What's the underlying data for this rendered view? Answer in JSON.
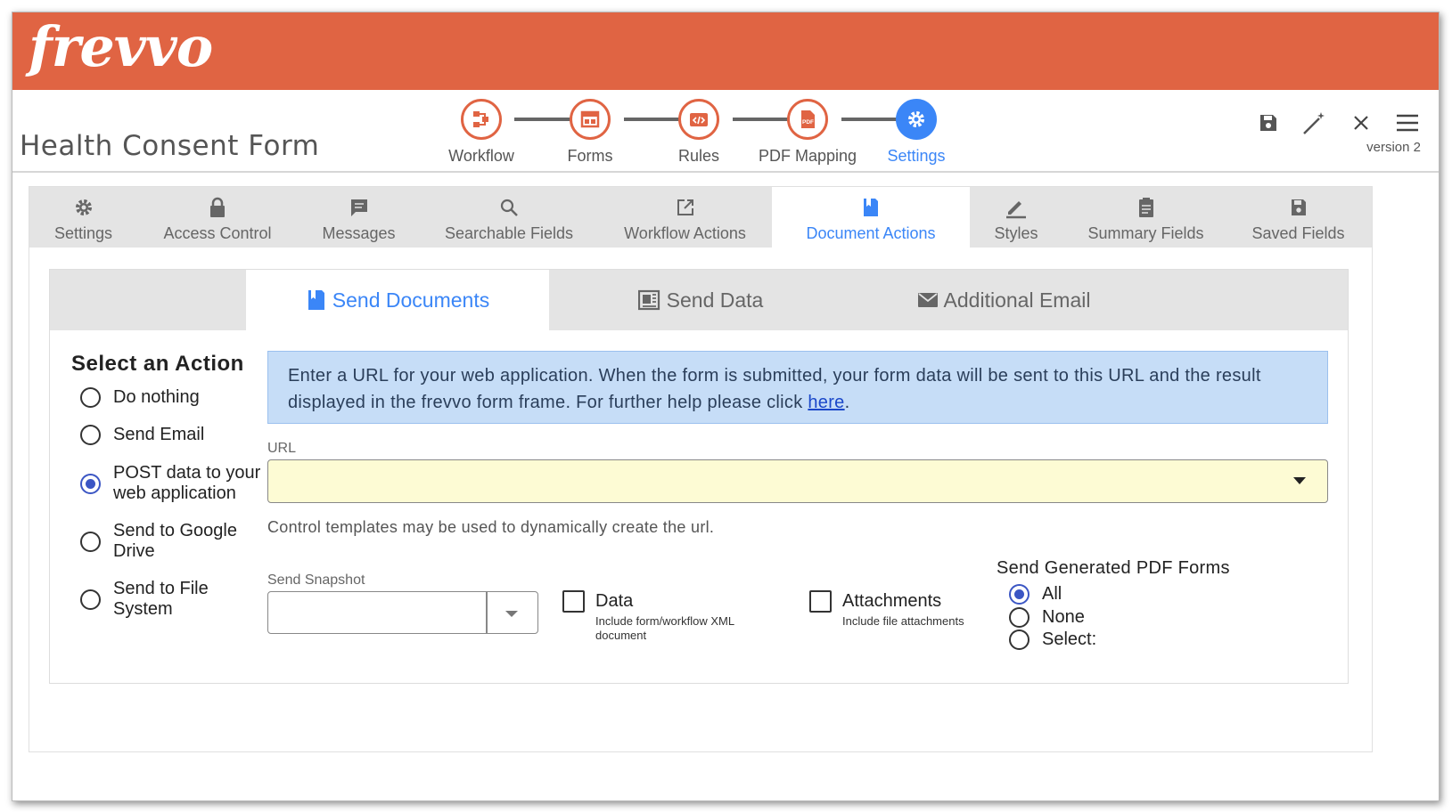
{
  "app": {
    "logo_text": "frevvo",
    "form_title": "Health Consent Form",
    "version": "version 2",
    "colors": {
      "brand": "#e06443",
      "accent": "#3b86f7",
      "info_bg": "#c6ddf7",
      "url_bg": "#fdfbd4"
    }
  },
  "steps": [
    {
      "label": "Workflow",
      "icon": "workflow-icon"
    },
    {
      "label": "Forms",
      "icon": "forms-icon"
    },
    {
      "label": "Rules",
      "icon": "rules-code-icon"
    },
    {
      "label": "PDF Mapping",
      "icon": "pdf-icon"
    },
    {
      "label": "Settings",
      "icon": "gear-icon",
      "active": true
    }
  ],
  "toolbar": {
    "icons": [
      "save-icon",
      "magic-wand-icon",
      "close-icon",
      "hamburger-menu-icon"
    ]
  },
  "settings_tabs": [
    {
      "label": "Settings",
      "icon": "gear-icon"
    },
    {
      "label": "Access Control",
      "icon": "lock-icon"
    },
    {
      "label": "Messages",
      "icon": "message-icon"
    },
    {
      "label": "Searchable Fields",
      "icon": "search-icon"
    },
    {
      "label": "Workflow Actions",
      "icon": "external-link-icon"
    },
    {
      "label": "Document Actions",
      "icon": "document-icon",
      "active": true
    },
    {
      "label": "Styles",
      "icon": "pencil-icon"
    },
    {
      "label": "Summary Fields",
      "icon": "clipboard-icon"
    },
    {
      "label": "Saved Fields",
      "icon": "save-icon"
    }
  ],
  "doc_tabs": [
    {
      "label": "Send Documents",
      "icon": "book-icon",
      "active": true
    },
    {
      "label": "Send Data",
      "icon": "data-icon"
    },
    {
      "label": "Additional Email",
      "icon": "envelope-icon"
    }
  ],
  "actions": {
    "title": "Select an Action",
    "options": [
      {
        "label": "Do nothing",
        "selected": false
      },
      {
        "label": "Send Email",
        "selected": false
      },
      {
        "label": "POST data to your web application",
        "selected": true
      },
      {
        "label": "Send to Google Drive",
        "selected": false
      },
      {
        "label": "Send to File System",
        "selected": false
      }
    ]
  },
  "info": {
    "text": "Enter a URL for your web application. When the form is submitted, your form data will be sent to this URL and the result displayed in the frevvo form frame. For further help please click ",
    "link_text": "here",
    "end": "."
  },
  "url": {
    "label": "URL",
    "value": ""
  },
  "helper_text": "Control templates may be used to dynamically create the url.",
  "snapshot": {
    "label": "Send Snapshot",
    "value": ""
  },
  "data_check": {
    "label": "Data",
    "sub": "Include form/workflow XML document",
    "checked": false
  },
  "attach_check": {
    "label": "Attachments",
    "sub": "Include file attachments",
    "checked": false
  },
  "pdf_forms": {
    "title": "Send Generated PDF Forms",
    "options": [
      {
        "label": "All",
        "selected": true
      },
      {
        "label": "None",
        "selected": false
      },
      {
        "label": "Select:",
        "selected": false
      }
    ]
  }
}
